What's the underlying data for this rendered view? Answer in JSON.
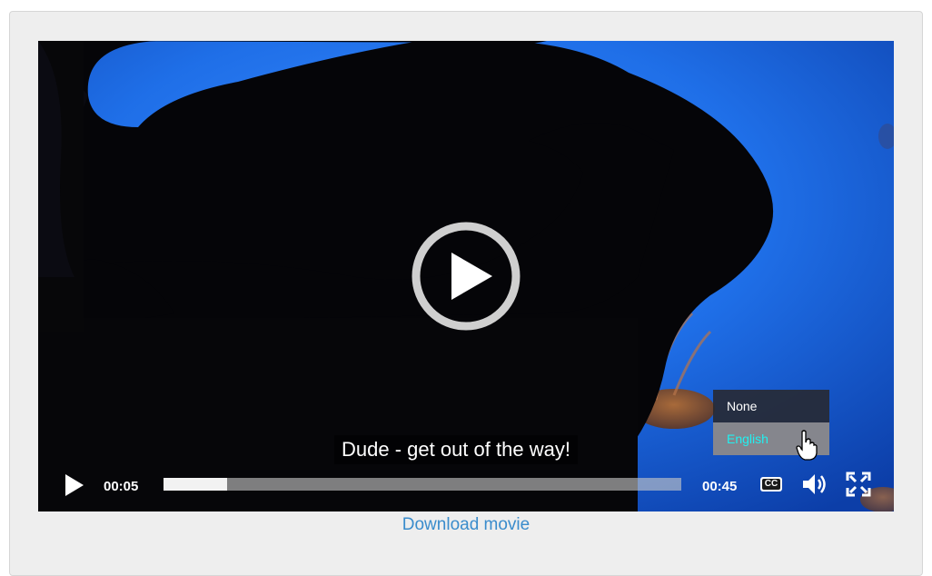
{
  "player": {
    "caption": "Dude - get out of the way!",
    "current_time": "00:05",
    "duration": "00:45",
    "progress_fraction": 0.123
  },
  "captions_menu": {
    "items": [
      {
        "label": "None",
        "selected": false
      },
      {
        "label": "English",
        "selected": true
      }
    ]
  },
  "cc_label": "CC",
  "download_link": "Download movie",
  "icons": [
    "big-play-icon",
    "play-icon",
    "cc-icon",
    "volume-icon",
    "fullscreen-icon",
    "hand-cursor-icon"
  ],
  "colors": {
    "panel_bg": "#eeeeee",
    "link": "#3a8ccc",
    "selected_caption": "#21f0f0",
    "water": "#1f6fe8",
    "jellyfish": "#f08a2a"
  }
}
